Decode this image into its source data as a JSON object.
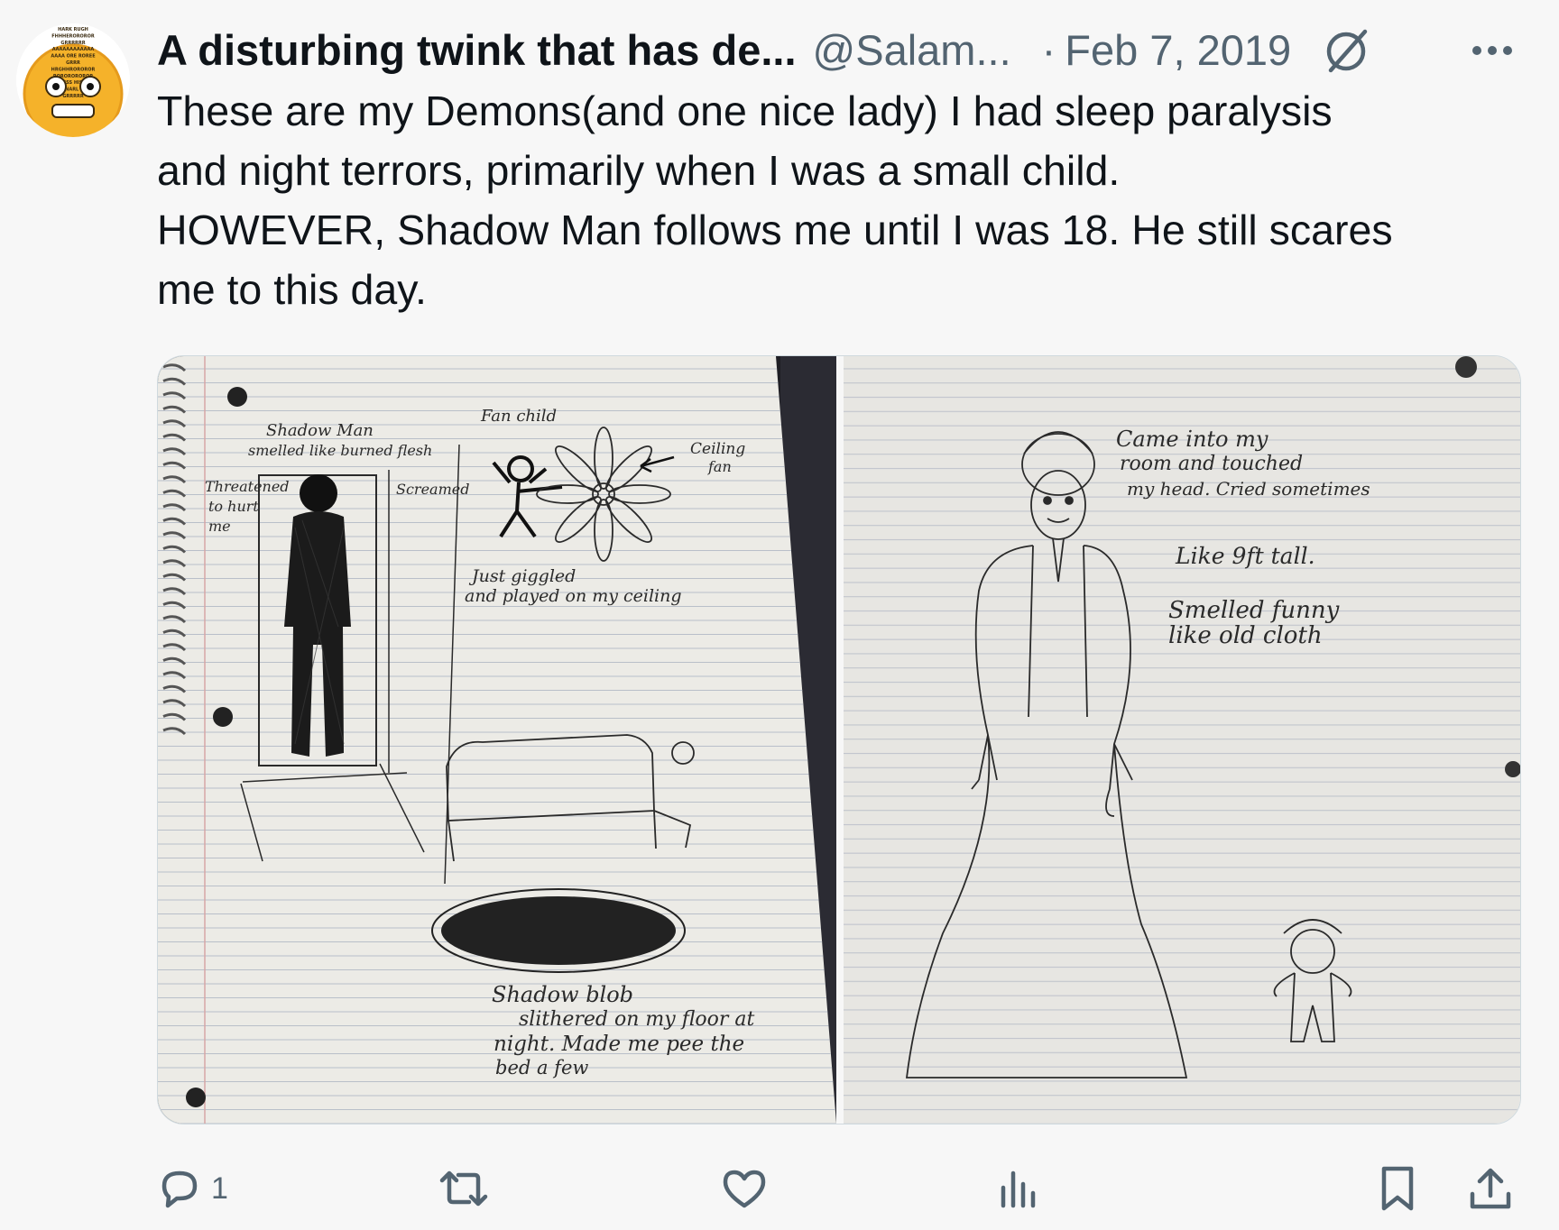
{
  "tweet": {
    "display_name": "A disturbing twink that has de...",
    "handle": "@Salam...",
    "separator": "·",
    "date": "Feb 7, 2019",
    "text": "These are my Demons(and one nice lady) I had sleep paralysis\nand night terrors, primarily when I was a small child.\nHOWEVER, Shadow Man follows me until I was 18. He still scares\nme to this day."
  },
  "avatar": {
    "lines": [
      "HARK RUGH",
      "FHHHEROROROR",
      "GRRRRRR",
      "AAAAAAAAAAAA",
      "AAAA ORE ROREE",
      "GRRR",
      "HRGHHROROROR",
      "ROROROROROR",
      "HISSSS HISSSS",
      "BITE SNARL SNARL",
      "GRRRRR"
    ]
  },
  "left_photo_notes": {
    "shadow_man": [
      "Shadow Man",
      "smelled like burned flesh"
    ],
    "threatened": [
      "Threatened",
      "to hurt",
      "me"
    ],
    "screamed": "Screamed",
    "fan_child": "Fan child",
    "ceiling_fan": [
      "Ceiling",
      "fan"
    ],
    "giggled": [
      "Just giggled",
      "and played on my ceiling"
    ],
    "shadow_blob": [
      "Shadow blob",
      "slithered on my floor at",
      "night. Made me pee the",
      "bed a few"
    ]
  },
  "right_photo_notes": {
    "came_into": [
      "Came into my",
      "room and touched",
      "my head. Cried sometimes"
    ],
    "tall": "Like 9ft tall.",
    "smelled": [
      "Smelled funny",
      "like old cloth"
    ]
  },
  "actions": {
    "reply_count": "1",
    "icons": [
      "reply-icon",
      "retweet-icon",
      "like-icon",
      "views-icon",
      "bookmark-icon",
      "share-icon"
    ]
  },
  "colors": {
    "secondary_text": "#536471",
    "paper": "#ecebe6",
    "ink": "#2a2a2a"
  }
}
